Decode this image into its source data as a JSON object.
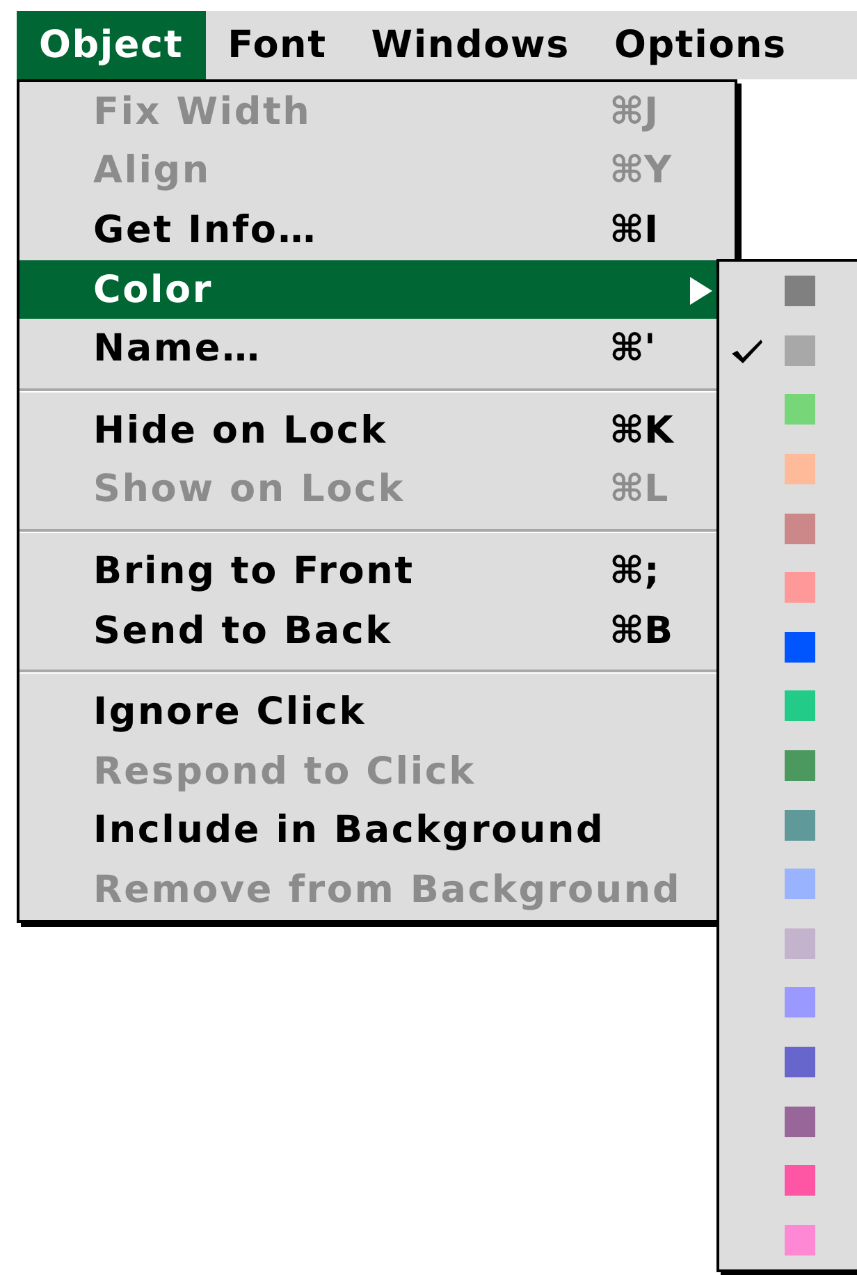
{
  "menubar": [
    {
      "label": "Object",
      "selected": true
    },
    {
      "label": "Font",
      "selected": false
    },
    {
      "label": "Windows",
      "selected": false
    },
    {
      "label": "Options",
      "selected": false
    }
  ],
  "menu": {
    "groups": [
      {
        "items": [
          {
            "label": "Fix Width",
            "shortcut": "⌘J",
            "disabled": true,
            "selected": false,
            "kind": "command"
          },
          {
            "label": "Align",
            "shortcut": "⌘Y",
            "disabled": true,
            "selected": false,
            "kind": "command"
          },
          {
            "label": "Get Info…",
            "shortcut": "⌘I",
            "disabled": false,
            "selected": false,
            "kind": "command"
          },
          {
            "label": "Color",
            "disabled": false,
            "selected": true,
            "kind": "submenu"
          },
          {
            "label": "Name…",
            "shortcut": "⌘'",
            "disabled": false,
            "selected": false,
            "kind": "command"
          }
        ]
      },
      {
        "items": [
          {
            "label": "Hide on Lock",
            "shortcut": "⌘K",
            "disabled": false,
            "selected": false,
            "kind": "command"
          },
          {
            "label": "Show on Lock",
            "shortcut": "⌘L",
            "disabled": true,
            "selected": false,
            "kind": "command"
          }
        ]
      },
      {
        "items": [
          {
            "label": "Bring to Front",
            "shortcut": "⌘;",
            "disabled": false,
            "selected": false,
            "kind": "command"
          },
          {
            "label": "Send to Back",
            "shortcut": "⌘B",
            "disabled": false,
            "selected": false,
            "kind": "command"
          }
        ]
      },
      {
        "items": [
          {
            "label": "Ignore Click",
            "disabled": false,
            "selected": false,
            "kind": "command"
          },
          {
            "label": "Respond to Click",
            "disabled": true,
            "selected": false,
            "kind": "command"
          },
          {
            "label": "Include in Background",
            "disabled": false,
            "selected": false,
            "kind": "command"
          },
          {
            "label": "Remove from Background",
            "disabled": true,
            "selected": false,
            "kind": "command"
          }
        ]
      }
    ]
  },
  "submenu": {
    "items": [
      {
        "color": "#808080",
        "checked": false
      },
      {
        "color": "#a8a8a8",
        "checked": true
      },
      {
        "color": "#77d677",
        "checked": false
      },
      {
        "color": "#ffbb99",
        "checked": false
      },
      {
        "color": "#cc8888",
        "checked": false
      },
      {
        "color": "#ff9999",
        "checked": false
      },
      {
        "color": "#0055ff",
        "checked": false
      },
      {
        "color": "#22cc88",
        "checked": false
      },
      {
        "color": "#4c9960",
        "checked": false
      },
      {
        "color": "#5f9999",
        "checked": false
      },
      {
        "color": "#99b3ff",
        "checked": false
      },
      {
        "color": "#c4b3cc",
        "checked": false
      },
      {
        "color": "#9999ff",
        "checked": false
      },
      {
        "color": "#6666cc",
        "checked": false
      },
      {
        "color": "#996699",
        "checked": false
      },
      {
        "color": "#ff55a5",
        "checked": false
      },
      {
        "color": "#ff88d5",
        "checked": false
      }
    ]
  }
}
